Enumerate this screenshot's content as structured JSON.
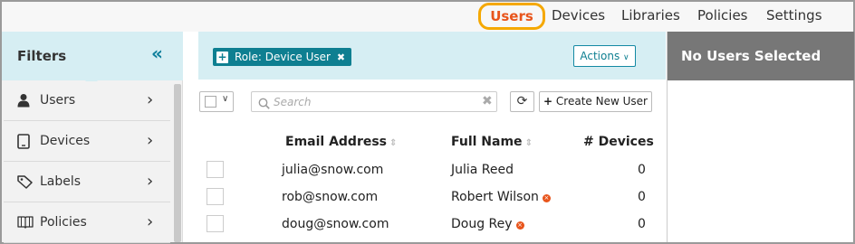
{
  "nav": {
    "users": "Users",
    "devices": "Devices",
    "libraries": "Libraries",
    "policies": "Policies",
    "settings": "Settings",
    "active_color": "#e8541b",
    "highlight_color": "#f5a800"
  },
  "filters": {
    "title": "Filters",
    "collapse_icon": "double-chevron-left-icon",
    "items": [
      {
        "label": "Users",
        "icon": "user-icon"
      },
      {
        "label": "Devices",
        "icon": "tablet-icon"
      },
      {
        "label": "Labels",
        "icon": "tag-icon"
      },
      {
        "label": "Policies",
        "icon": "book-icon"
      }
    ]
  },
  "main": {
    "role_chip": "Role: Device User",
    "actions_label": "Actions",
    "search_placeholder": "Search",
    "create_label": "Create New User",
    "columns": {
      "email": "Email Address",
      "name": "Full Name",
      "devices": "# Devices"
    },
    "rows": [
      {
        "email": "julia@snow.com",
        "name": "Julia Reed",
        "devices": "0",
        "warning": false
      },
      {
        "email": "rob@snow.com",
        "name": "Robert Wilson",
        "devices": "0",
        "warning": true
      },
      {
        "email": "doug@snow.com",
        "name": "Doug Rey",
        "devices": "0",
        "warning": true
      }
    ],
    "accent_color": "#0e7f91"
  },
  "detail": {
    "title": "No Users Selected"
  }
}
